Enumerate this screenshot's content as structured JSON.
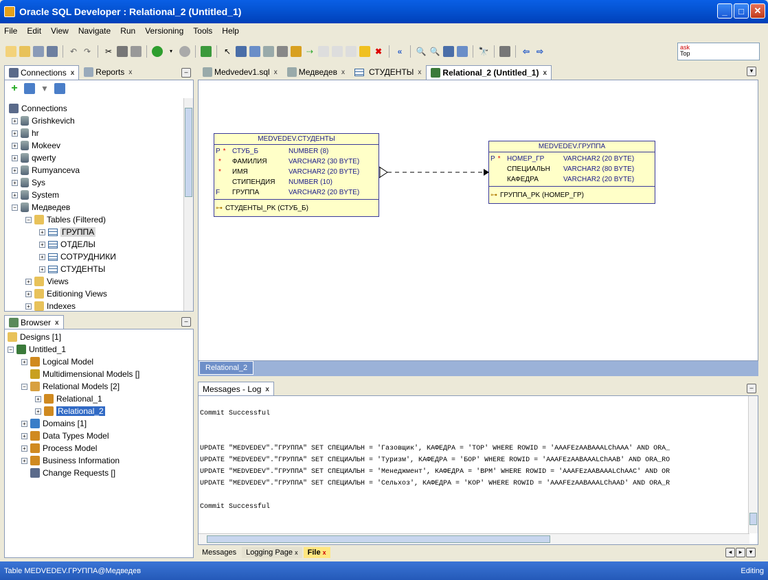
{
  "window": {
    "title": "Oracle SQL Developer : Relational_2 (Untitled_1)"
  },
  "menu": [
    "File",
    "Edit",
    "View",
    "Navigate",
    "Run",
    "Versioning",
    "Tools",
    "Help"
  ],
  "ask": {
    "line1": "ask",
    "line2": "Top"
  },
  "connections_panel": {
    "tabs": [
      {
        "label": "Connections",
        "active": true
      },
      {
        "label": "Reports",
        "active": false
      }
    ],
    "tree": [
      {
        "label": "Connections",
        "level": 0,
        "icon": "connections-icon"
      },
      {
        "label": "Grishkevich",
        "level": 1,
        "icon": "database-icon"
      },
      {
        "label": "hr",
        "level": 1,
        "icon": "database-icon"
      },
      {
        "label": "Mokeev",
        "level": 1,
        "icon": "database-icon"
      },
      {
        "label": "qwerty",
        "level": 1,
        "icon": "database-icon"
      },
      {
        "label": "Rumyanceva",
        "level": 1,
        "icon": "database-icon"
      },
      {
        "label": "Sys",
        "level": 1,
        "icon": "database-icon"
      },
      {
        "label": "System",
        "level": 1,
        "icon": "database-icon"
      },
      {
        "label": "Медведев",
        "level": 1,
        "icon": "database-icon"
      },
      {
        "label": "Tables (Filtered)",
        "level": 2,
        "icon": "folder-icon"
      },
      {
        "label": "ГРУППА",
        "level": 3,
        "icon": "table-icon"
      },
      {
        "label": "ОТДЕЛЫ",
        "level": 3,
        "icon": "table-icon"
      },
      {
        "label": "СОТРУДНИКИ",
        "level": 3,
        "icon": "table-icon"
      },
      {
        "label": "СТУДЕНТЫ",
        "level": 3,
        "icon": "table-icon"
      },
      {
        "label": "Views",
        "level": 2,
        "icon": "folder-icon"
      },
      {
        "label": "Editioning Views",
        "level": 2,
        "icon": "folder-icon"
      },
      {
        "label": "Indexes",
        "level": 2,
        "icon": "folder-icon"
      }
    ]
  },
  "browser_panel": {
    "tab": "Browser",
    "tree": [
      {
        "label": "Designs [1]",
        "level": 0
      },
      {
        "label": "Untitled_1",
        "level": 0
      },
      {
        "label": "Logical Model",
        "level": 1
      },
      {
        "label": "Multidimensional Models []",
        "level": 1
      },
      {
        "label": "Relational Models [2]",
        "level": 1
      },
      {
        "label": "Relational_1",
        "level": 2
      },
      {
        "label": "Relational_2",
        "level": 2
      },
      {
        "label": "Domains [1]",
        "level": 1
      },
      {
        "label": "Data Types Model",
        "level": 1
      },
      {
        "label": "Process Model",
        "level": 1
      },
      {
        "label": "Business Information",
        "level": 1
      },
      {
        "label": "Change Requests []",
        "level": 1
      }
    ]
  },
  "editor_tabs": [
    {
      "label": "Medvedev1.sql",
      "active": false
    },
    {
      "label": "Медведев",
      "active": false
    },
    {
      "label": "СТУДЕНТЫ",
      "active": false
    },
    {
      "label": "Relational_2 (Untitled_1)",
      "active": true
    }
  ],
  "diagram": {
    "subtab": "Relational_2",
    "entities": [
      {
        "title": "MEDVEDEV.СТУДЕНТЫ",
        "columns": [
          {
            "pk": "P",
            "req": "*",
            "name": "СТУБ_Б",
            "type": "NUMBER (8)"
          },
          {
            "pk": "",
            "req": "*",
            "name": "ФАМИЛИЯ",
            "type": "VARCHAR2 (30 BYTE)"
          },
          {
            "pk": "",
            "req": "*",
            "name": "ИМЯ",
            "type": "VARCHAR2 (20 BYTE)"
          },
          {
            "pk": "",
            "req": "",
            "name": "СТИПЕНДИЯ",
            "type": "NUMBER (10)"
          },
          {
            "pk": "F",
            "req": "",
            "name": "ГРУППА",
            "type": "VARCHAR2 (20 BYTE)"
          }
        ],
        "key": "СТУДЕНТЫ_PK (СТУБ_Б)"
      },
      {
        "title": "MEDVEDEV.ГРУППА",
        "columns": [
          {
            "pk": "P",
            "req": "*",
            "name": "НОМЕР_ГР",
            "type": "VARCHAR2 (20 BYTE)"
          },
          {
            "pk": "",
            "req": "",
            "name": "СПЕЦИАЛЬН",
            "type": "VARCHAR2 (80 BYTE)"
          },
          {
            "pk": "",
            "req": "",
            "name": "КАФЕДРА",
            "type": "VARCHAR2 (20 BYTE)"
          }
        ],
        "key": "ГРУППА_PK (НОМЕР_ГР)"
      }
    ]
  },
  "messages": {
    "tab": "Messages - Log",
    "lines": [
      "Commit Successful",
      "",
      "",
      "UPDATE \"MEDVEDEV\".\"ГРУППА\" SET СПЕЦИАЛЬН = 'Газовщик', КАФЕДРА = 'ТОР' WHERE ROWID = 'AAAFEzAABAAALChAAA' AND ORA_",
      "UPDATE \"MEDVEDEV\".\"ГРУППА\" SET СПЕЦИАЛЬН = 'Туризм', КАФЕДРА = 'БОР' WHERE ROWID = 'AAAFEzAABAAALChAAB' AND ORA_RO",
      "UPDATE \"MEDVEDEV\".\"ГРУППА\" SET СПЕЦИАЛЬН = 'Менеджмент', КАФЕДРА = 'ВРМ' WHERE ROWID = 'AAAFEzAABAAALChAAC' AND OR",
      "UPDATE \"MEDVEDEV\".\"ГРУППА\" SET СПЕЦИАЛЬН = 'Сельхоз', КАФЕДРА = 'КОР' WHERE ROWID = 'AAAFEzAABAAALChAAD' AND ORA_R",
      "",
      "Commit Successful"
    ],
    "bottom_tabs": [
      {
        "label": "Messages"
      },
      {
        "label": "Logging Page"
      },
      {
        "label": "File"
      }
    ]
  },
  "status": {
    "left": "Table MEDVEDEV.ГРУППА@Медведев",
    "right": "Editing"
  }
}
